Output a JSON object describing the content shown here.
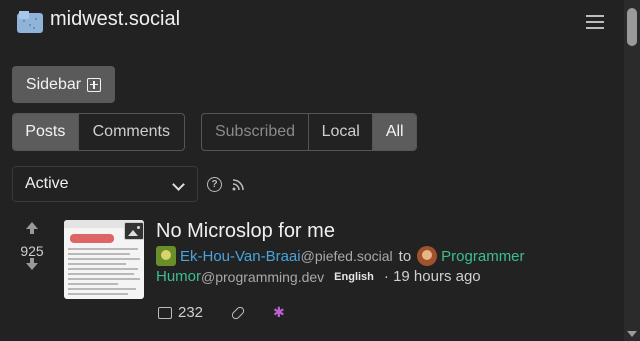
{
  "site": {
    "name": "midwest.social"
  },
  "sidebar_button": {
    "label": "Sidebar"
  },
  "view_toggle": {
    "items": [
      "Posts",
      "Comments"
    ],
    "active": "Posts"
  },
  "listing_toggle": {
    "items": [
      "Subscribed",
      "Local",
      "All"
    ],
    "active": "All"
  },
  "sort": {
    "selected": "Active"
  },
  "post": {
    "title": "No Microslop for me",
    "score": "925",
    "author": "Ek-Hou-Van-Braai",
    "author_instance": "@piefed.social",
    "to_word": "to",
    "community_line1": "Programmer",
    "community_line2": "Humor",
    "community_instance": "@programming.dev",
    "language": "English",
    "time": "· 19 hours ago",
    "comments": "232"
  },
  "colors": {
    "background": "#222222",
    "active_button": "#5c5c5c",
    "author_link": "#4aa3df",
    "community_link": "#3cbf8f"
  }
}
